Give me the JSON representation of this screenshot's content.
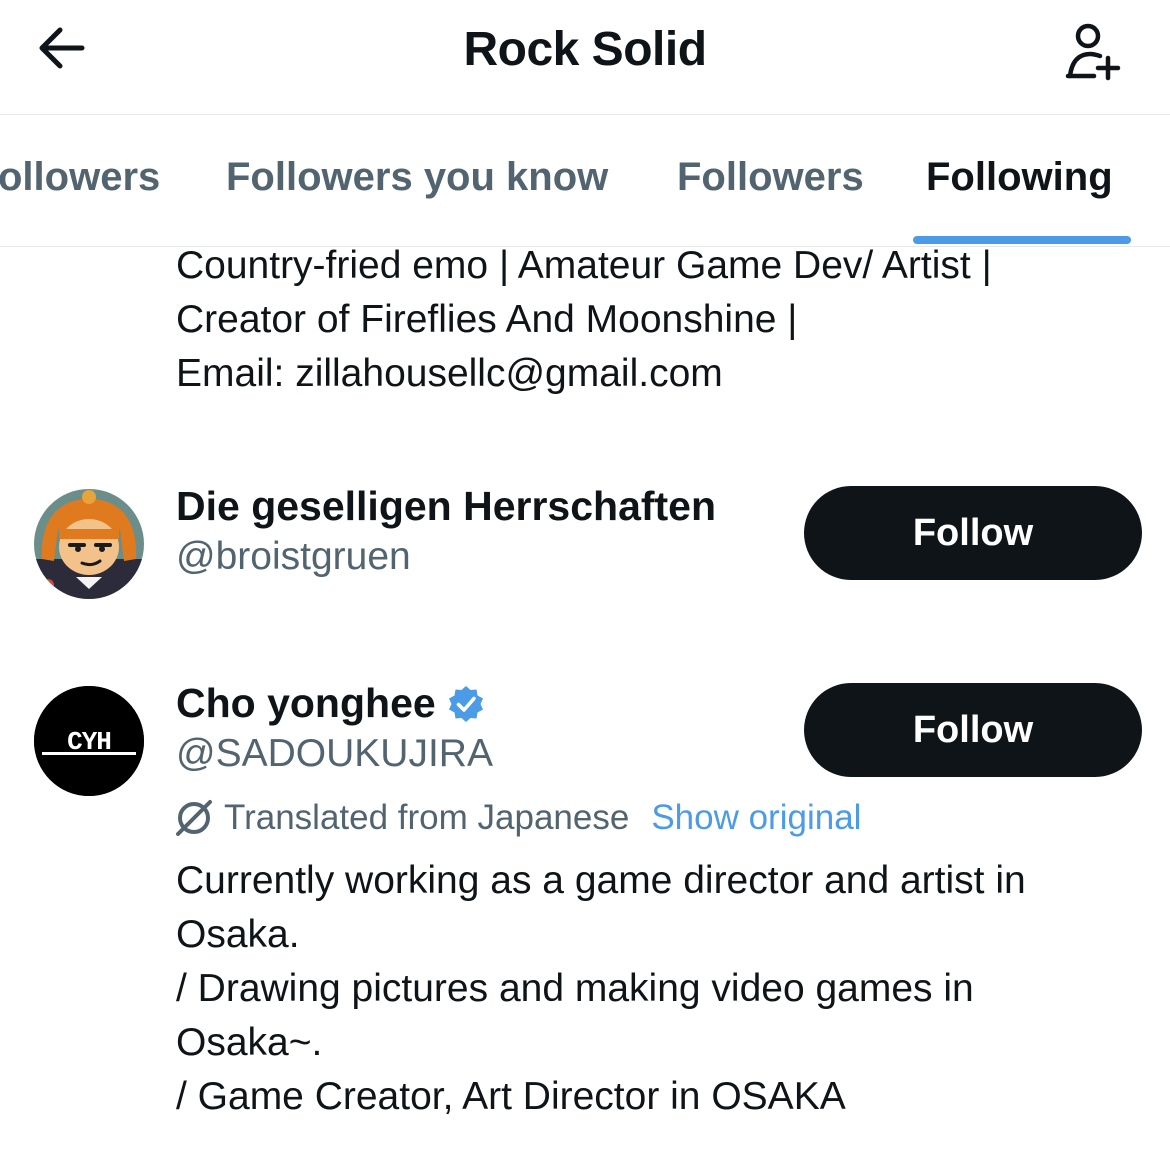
{
  "header": {
    "title": "Rock Solid",
    "back_icon": "arrow-left-icon",
    "add_user_icon": "add-user-icon"
  },
  "tabs": [
    {
      "label": "ollowers",
      "active": false
    },
    {
      "label": "Followers you know",
      "active": false
    },
    {
      "label": "Followers",
      "active": false
    },
    {
      "label": "Following",
      "active": true
    }
  ],
  "colors": {
    "accent": "#4c9be6",
    "text_primary": "#0f1419",
    "text_secondary": "#536471",
    "button_bg": "#0f1419"
  },
  "users": [
    {
      "bio_lines": [
        "Country-fried emo | Amateur Game Dev/ Artist |",
        "Creator of Fireflies And Moonshine |",
        "Email: zillahousellc@gmail.com"
      ]
    },
    {
      "name": "Die geselligen Herrschaften",
      "handle": "@broistgruen",
      "follow_label": "Follow",
      "verified": false
    },
    {
      "name": "Cho yonghee",
      "handle": "@SADOUKUJIRA",
      "follow_label": "Follow",
      "verified": true,
      "avatar_text": "CYH",
      "translated_label": "Translated from Japanese",
      "show_original_label": "Show original",
      "bio_lines": [
        "Currently working as a game director and artist in",
        "Osaka.",
        "/ Drawing pictures and making video games in",
        "Osaka~.",
        "/ Game Creator, Art Director in OSAKA"
      ]
    }
  ]
}
